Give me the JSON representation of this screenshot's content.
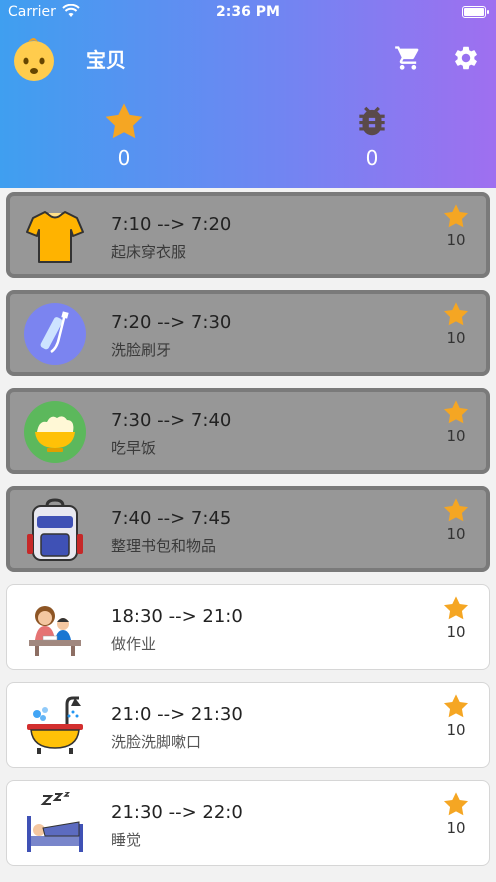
{
  "status_bar": {
    "carrier": "Carrier",
    "time": "2:36 PM"
  },
  "header": {
    "title": "宝贝",
    "stars": "0",
    "bugs": "0"
  },
  "colors": {
    "star": "#f5a623",
    "bug": "#5a4a4a",
    "accent": "#3f9ff0"
  },
  "tasks": [
    {
      "time": "7:10  -->  7:20",
      "name": "起床穿衣服",
      "points": "10",
      "done": true,
      "icon": "shirt-icon"
    },
    {
      "time": "7:20  -->  7:30",
      "name": "洗脸刷牙",
      "points": "10",
      "done": true,
      "icon": "toothbrush-icon"
    },
    {
      "time": "7:30  -->  7:40",
      "name": "吃早饭",
      "points": "10",
      "done": true,
      "icon": "rice-bowl-icon"
    },
    {
      "time": "7:40  -->  7:45",
      "name": "整理书包和物品",
      "points": "10",
      "done": true,
      "icon": "backpack-icon"
    },
    {
      "time": "18:30  -->  21:0",
      "name": "做作业",
      "points": "10",
      "done": false,
      "icon": "homework-icon"
    },
    {
      "time": "21:0  -->  21:30",
      "name": "洗脸洗脚嗽口",
      "points": "10",
      "done": false,
      "icon": "bathtub-icon"
    },
    {
      "time": "21:30  -->  22:0",
      "name": "睡觉",
      "points": "10",
      "done": false,
      "icon": "sleep-icon"
    }
  ]
}
